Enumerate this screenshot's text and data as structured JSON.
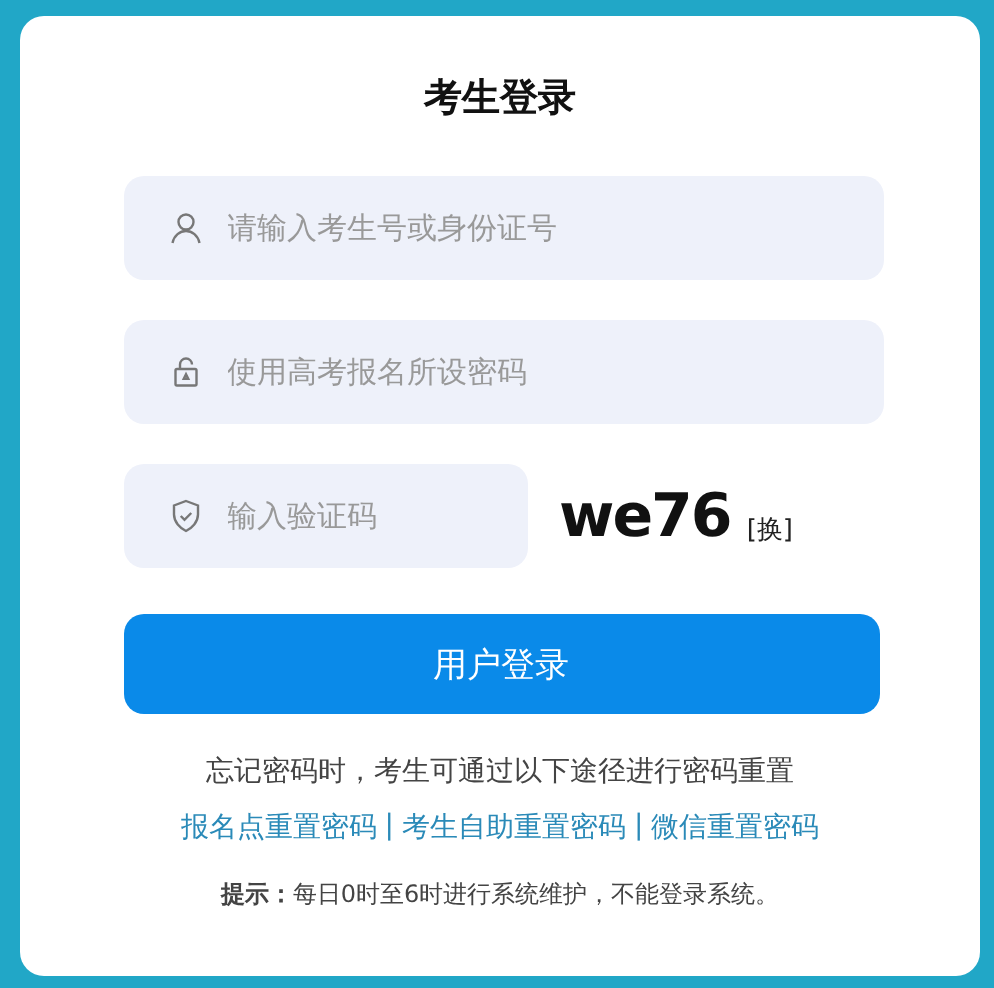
{
  "title": "考生登录",
  "fields": [
    {
      "kind": "user",
      "placeholder": "请输入考生号或身份证号"
    },
    {
      "kind": "lock",
      "placeholder": "使用高考报名所设密码"
    },
    {
      "kind": "shield",
      "placeholder": "输入验证码"
    }
  ],
  "captcha": {
    "code": "we76",
    "refresh": "[换]"
  },
  "login_button": "用户登录",
  "reset_note": "忘记密码时，考生可通过以下途径进行密码重置",
  "reset_links": [
    "报名点重置密码",
    "考生自助重置密码",
    "微信重置密码"
  ],
  "link_separator": "|",
  "notice": "**提示：**每日0时至6时进行系统维护，不能登录系统。"
}
